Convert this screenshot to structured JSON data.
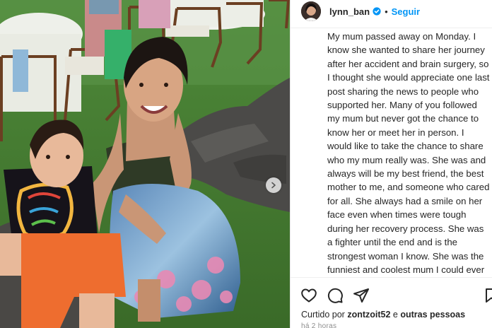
{
  "post": {
    "username": "lynn_ban",
    "separator": "•",
    "follow_label": "Seguir",
    "caption": "My mum passed away on Monday. I know she wanted to share her journey after her accident and brain surgery, so I thought she would appreciate one last post sharing the news to people who supported her. Many of you followed my mum but never got the chance to know her or meet her in person. I would like to take the chance to share who my mum really was. She was and always will be my best friend, the best mother to me, and someone who cared for all. She always had a smile on her face even when times were tough during her recovery process. She was a fighter until the end and is the strongest woman I know. She was the funniest and coolest mum I could ever ask for. She took care of me, my dad, and our Entire family throughout her whole life. Although she may be gone",
    "likes_prefix": "Curtido por",
    "likes_user": "zontzoit52",
    "likes_mid": "e",
    "likes_suffix": "outras pessoas",
    "time": "há 2 horas"
  },
  "icons": {
    "verified": "verified-badge-icon",
    "like": "heart-icon",
    "comment": "comment-icon",
    "share": "share-icon",
    "save": "bookmark-icon",
    "carousel": "chevron-right-icon"
  },
  "colors": {
    "accent": "#0095f6",
    "text": "#262626",
    "muted": "#8e8e8e"
  }
}
